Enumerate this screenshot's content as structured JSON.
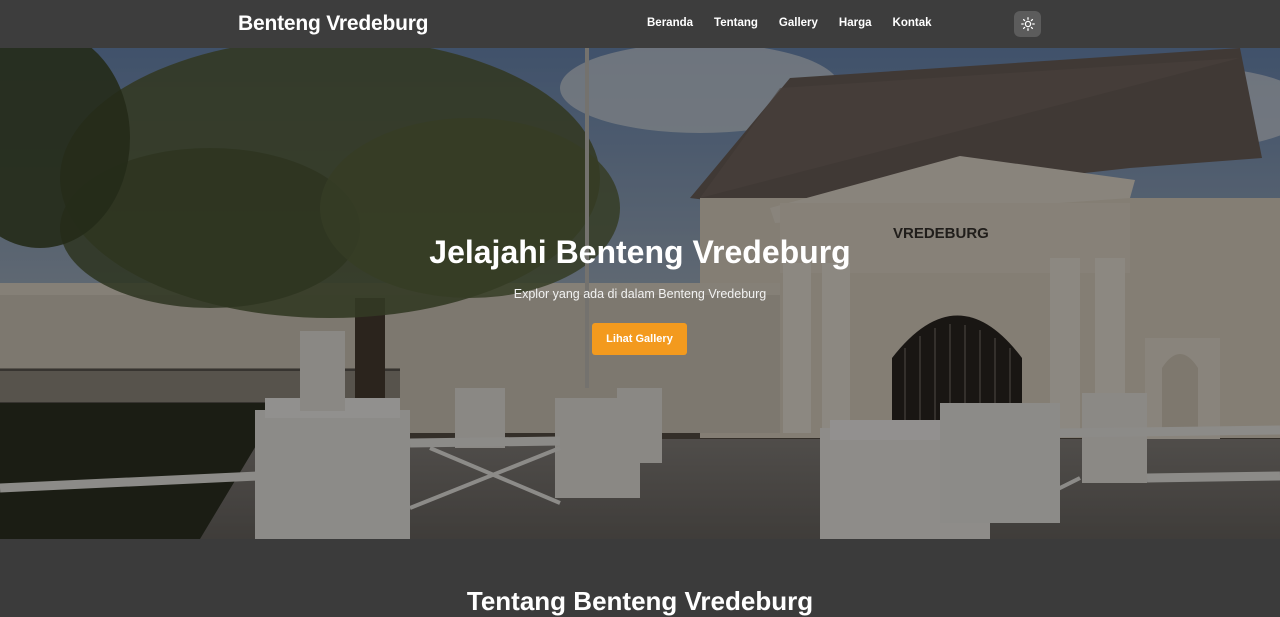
{
  "navbar": {
    "brand": "Benteng Vredeburg",
    "links": [
      "Beranda",
      "Tentang",
      "Gallery",
      "Harga",
      "Kontak"
    ],
    "theme_icon": "sun-icon"
  },
  "hero": {
    "title": "Jelajahi Benteng Vredeburg",
    "subtitle": "Explor yang ada di dalam Benteng Vredeburg",
    "button_label": "Lihat Gallery",
    "building_sign": "VREDEBURG",
    "button_color": "#f39a1e"
  },
  "about": {
    "title": "Tentang Benteng Vredeburg"
  }
}
